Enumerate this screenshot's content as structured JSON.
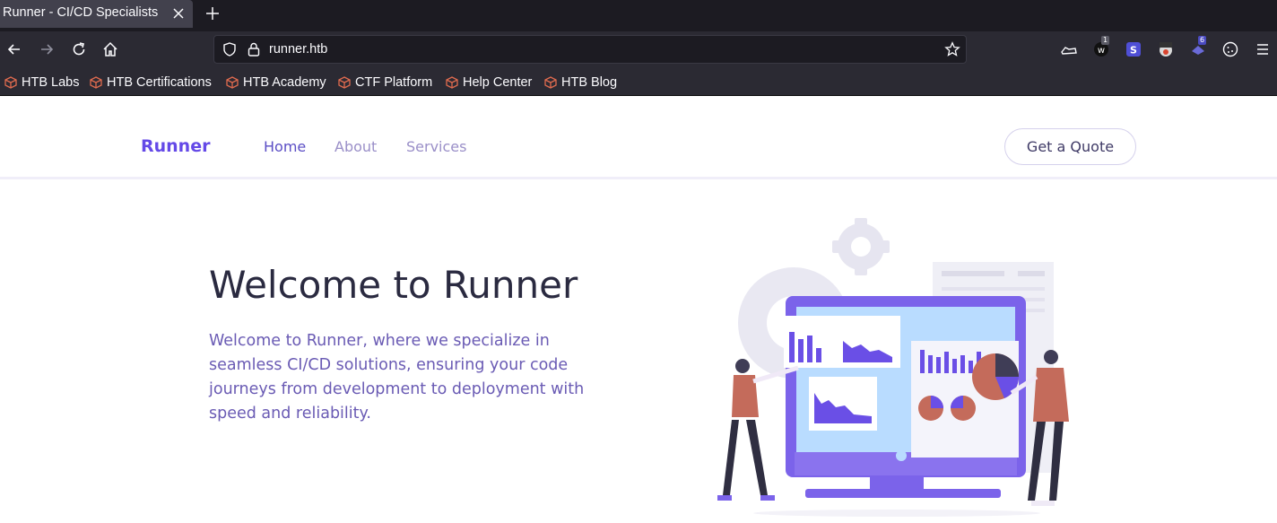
{
  "browser": {
    "tab_title": "Runner - CI/CD Specialists",
    "url": "runner.htb",
    "extension_badges": [
      "1",
      "6"
    ],
    "bookmarks": [
      {
        "label": "HTB Labs",
        "icon": "cube-icon"
      },
      {
        "label": "HTB Certifications",
        "icon": "cube-icon"
      },
      {
        "label": "HTB Academy",
        "icon": "cube-icon"
      },
      {
        "label": "CTF Platform",
        "icon": "cube-icon"
      },
      {
        "label": "Help Center",
        "icon": "cube-icon"
      },
      {
        "label": "HTB Blog",
        "icon": "cube-icon"
      }
    ]
  },
  "site": {
    "brand": "Runner",
    "nav": [
      {
        "label": "Home",
        "active": true
      },
      {
        "label": "About",
        "active": false
      },
      {
        "label": "Services",
        "active": false
      }
    ],
    "cta": "Get a Quote"
  },
  "hero": {
    "title": "Welcome to Runner",
    "text": "Welcome to Runner, where we specialize in seamless CI/CD solutions, ensuring your code journeys from development to deployment with speed and reliability."
  },
  "colors": {
    "accent": "#6449e7",
    "chrome_dark": "#1c1b22",
    "chrome": "#2b2a33",
    "bookmark_icon": "#e06b4f"
  }
}
